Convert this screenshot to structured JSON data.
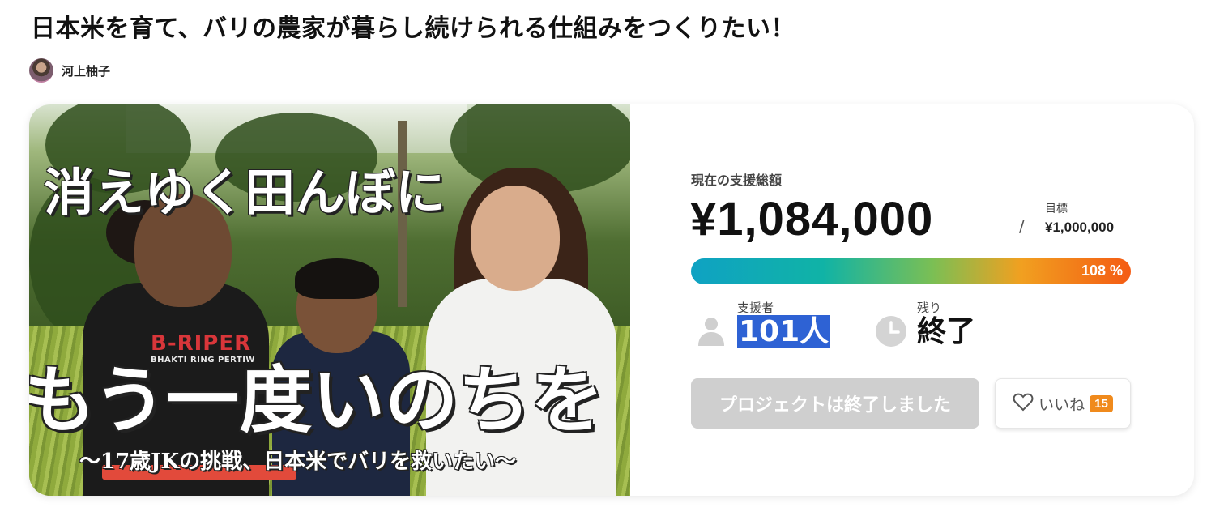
{
  "project": {
    "title": "日本米を育て、バリの農家が暮らし続けられる仕組みをつくりたい！",
    "author": "河上柚子"
  },
  "hero": {
    "headline_top": "消えゆく田んぼに",
    "headline_main": "もう一度いのちを",
    "subtitle": "〜17歳JKの挑戦、日本米でバリを救いたい〜",
    "shirt_text": "B-RIPER",
    "shirt_subtext": "BHAKTI RING PERTIW"
  },
  "stats": {
    "amount_label": "現在の支援総額",
    "amount": "¥1,084,000",
    "goal_separator": "/",
    "goal_label": "目標",
    "goal_value": "¥1,000,000",
    "progress_percent_text": "108 %",
    "progress_fraction": 1.08,
    "backers_label": "支援者",
    "backers_value": "101人",
    "remaining_label": "残り",
    "remaining_value": "終了"
  },
  "actions": {
    "ended_label": "プロジェクトは終了しました",
    "like_label": "いいね",
    "like_count": "15"
  },
  "icons": {
    "author_avatar": "avatar",
    "backers": "person-icon",
    "remaining": "clock-icon",
    "like": "heart-icon"
  },
  "colors": {
    "progress_start": "#0fa2c3",
    "progress_end": "#f45b13",
    "like_badge": "#f08a1c",
    "ended_button": "#cfcfcf",
    "selection_highlight": "#2e62d4"
  }
}
